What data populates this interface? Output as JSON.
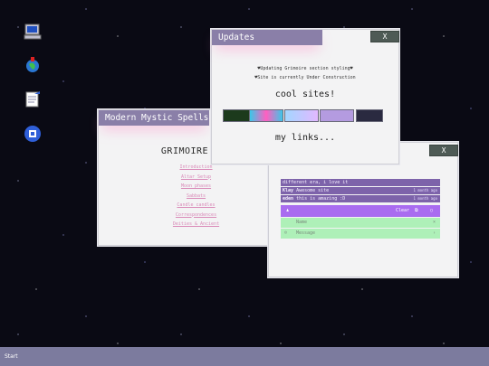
{
  "desktop": {
    "icons": [
      {
        "name": "computer-icon"
      },
      {
        "name": "globe-icon"
      },
      {
        "name": "notepad-icon"
      },
      {
        "name": "blue-app-icon"
      }
    ]
  },
  "grimoire_window": {
    "title": "Modern Mystic Spells",
    "heading": "GRIMOIRE",
    "links": [
      "Introduction",
      "Altar Setup",
      "Moon phases",
      "Sabbats",
      "Candle candles",
      "Correspondences",
      "Deities & Ancient"
    ]
  },
  "updates_window": {
    "title": "Updates",
    "close_label": "X",
    "line1": "♥Updating Grimoire section styling♥",
    "line2": "♥Site is currently Under Construction",
    "cool_sites": "cool sites!",
    "my_links": "my links...",
    "badges": [
      {
        "name": "site-badge-1",
        "color": "#1c3a1c"
      },
      {
        "name": "site-badge-2",
        "color": "#3bc7e8"
      },
      {
        "name": "site-badge-3",
        "color": "#a3d6ff"
      },
      {
        "name": "site-badge-4",
        "color": "#b49be0"
      },
      {
        "name": "site-badge-5",
        "color": "#2a2a40"
      }
    ]
  },
  "chat_window": {
    "close_label": "X",
    "messages": [
      {
        "nick": "",
        "text": "different era, i love it",
        "time": ""
      },
      {
        "nick": "Klay",
        "text": "Awesome site",
        "time": "1 month ago"
      },
      {
        "nick": "eden",
        "text": "this is amazing :D",
        "time": "1 month ago"
      }
    ],
    "bar_label": "Clear",
    "name_placeholder": "Name",
    "message_placeholder": "Message"
  },
  "taskbar": {
    "start_label": "Start"
  },
  "colors": {
    "title_bar": "#8a7fa8",
    "accent_pink": "#d98ab8",
    "chat_purple": "#a96cf0",
    "chat_green": "#aef0b8"
  }
}
